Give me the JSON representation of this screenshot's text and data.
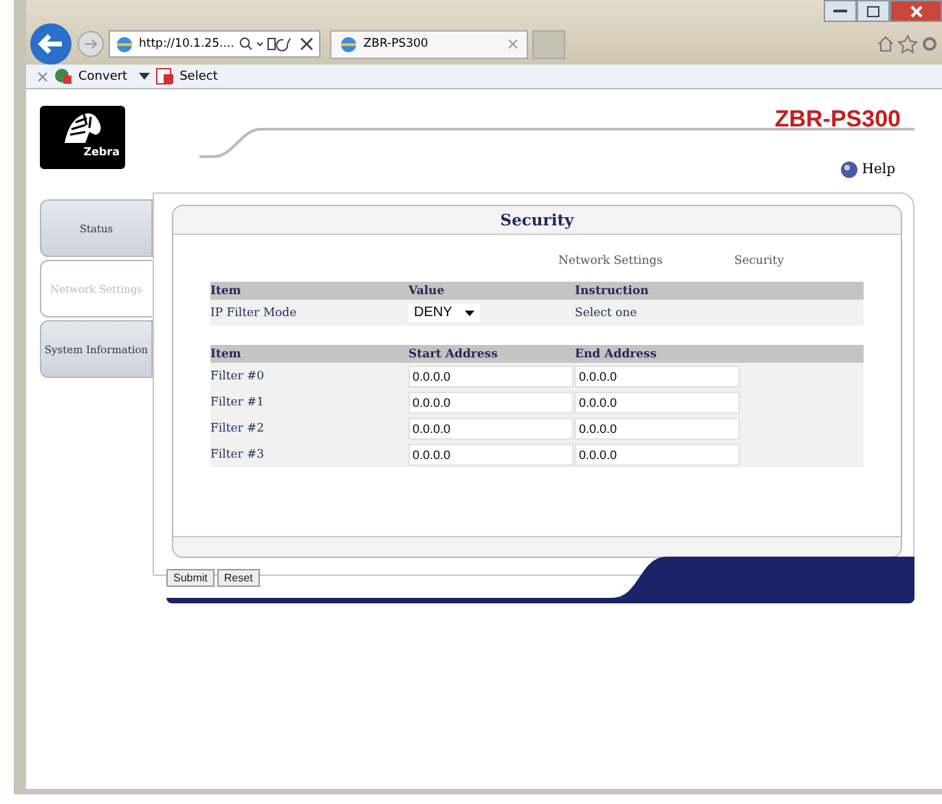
{
  "browser": {
    "address": "http://10.1.25....",
    "tab_title": "ZBR-PS300",
    "toolbar": [
      "Convert",
      "Select"
    ]
  },
  "header": {
    "logo_text": "Zebra",
    "model": "ZBR-PS300",
    "help": "Help"
  },
  "tabs": [
    {
      "label": "Status",
      "selected": false
    },
    {
      "label": "Network Settings",
      "selected": true
    },
    {
      "label": "System Information",
      "selected": false
    }
  ],
  "panel": {
    "title": "Security",
    "breadcrumb": [
      "Network Settings",
      "Security"
    ]
  },
  "mode_table": {
    "columns": [
      "Item",
      "Value",
      "Instruction"
    ],
    "row": {
      "item": "IP Filter Mode",
      "value": "DENY",
      "instruction": "Select one"
    }
  },
  "filter_table": {
    "columns": [
      "Item",
      "Start Address",
      "End Address"
    ],
    "rows": [
      {
        "item": "Filter #0",
        "start": "0.0.0.0",
        "end": "0.0.0.0"
      },
      {
        "item": "Filter #1",
        "start": "0.0.0.0",
        "end": "0.0.0.0"
      },
      {
        "item": "Filter #2",
        "start": "0.0.0.0",
        "end": "0.0.0.0"
      },
      {
        "item": "Filter #3",
        "start": "0.0.0.0",
        "end": "0.0.0.0"
      }
    ]
  },
  "buttons": [
    "Submit",
    "Reset"
  ]
}
